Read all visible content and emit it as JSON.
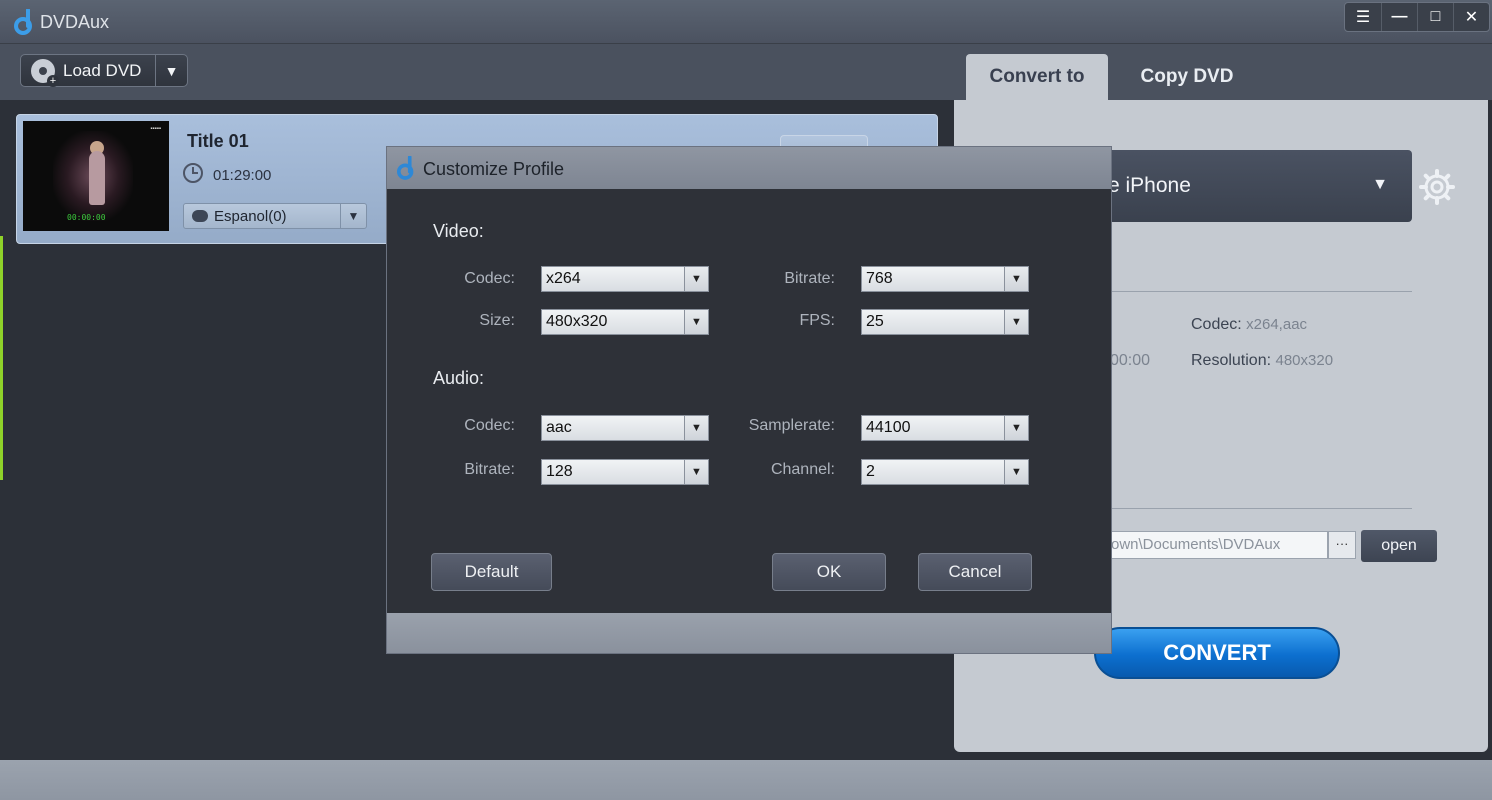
{
  "app": {
    "title": "DVDAux"
  },
  "window_controls": {
    "menu": "☰",
    "minimize": "—",
    "maximize": "□",
    "close": "✕"
  },
  "toolbar": {
    "load_label": "Load DVD",
    "dropdown": "▼"
  },
  "tabs": [
    {
      "label": "Convert to",
      "active": true
    },
    {
      "label": "Copy DVD",
      "active": false
    }
  ],
  "title_card": {
    "title": "Title 01",
    "duration": "01:29:00",
    "subtitle": "Espanol(0)",
    "dropdown": "▼",
    "thumb_caption": "00:00:00"
  },
  "right_panel": {
    "profile_visible": "e iPhone",
    "profile_dropdown": "▼",
    "codec_label": "Codec:",
    "codec_value": "x264,aac",
    "resolution_label": "Resolution:",
    "resolution_value": "480x320",
    "partial_duration": "00:00",
    "output_path": "own\\Documents\\DVDAux",
    "browse_label": "···",
    "open_label": "open",
    "convert_label": "CONVERT"
  },
  "dialog": {
    "title": "Customize Profile",
    "video_section": "Video:",
    "audio_section": "Audio:",
    "video": {
      "codec_label": "Codec:",
      "codec_value": "x264",
      "bitrate_label": "Bitrate:",
      "bitrate_value": "768",
      "size_label": "Size:",
      "size_value": "480x320",
      "fps_label": "FPS:",
      "fps_value": "25"
    },
    "audio": {
      "codec_label": "Codec:",
      "codec_value": "aac",
      "samplerate_label": "Samplerate:",
      "samplerate_value": "44100",
      "bitrate_label": "Bitrate:",
      "bitrate_value": "128",
      "channel_label": "Channel:",
      "channel_value": "2"
    },
    "dropdown": "▼",
    "default_label": "Default",
    "ok_label": "OK",
    "cancel_label": "Cancel"
  },
  "colors": {
    "accent": "#0c6fcf",
    "card": "#a9bfdc",
    "panel": "#c5cad1",
    "background": "#2c3038"
  }
}
